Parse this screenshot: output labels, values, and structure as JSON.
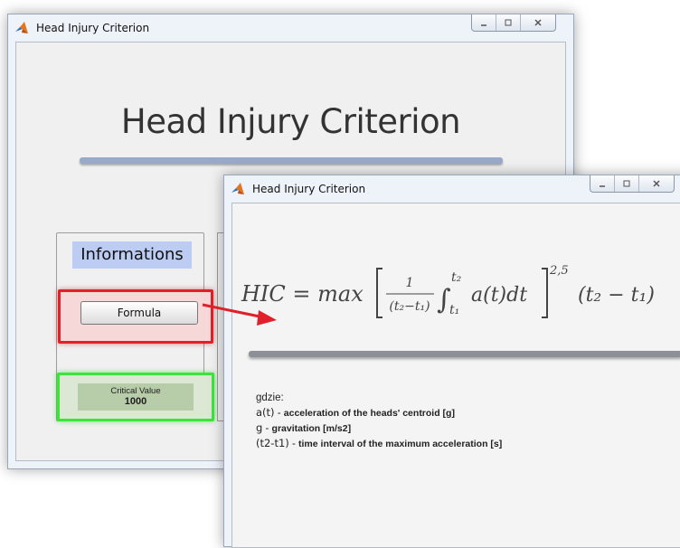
{
  "main_window": {
    "title": "Head Injury Criterion",
    "heading": "Head Injury Criterion",
    "informations_label": "Informations",
    "formula_button": "Formula",
    "critical_value_label": "Critical Value",
    "critical_value": "1000",
    "window_controls": {
      "minimize": "_",
      "maximize": "▫",
      "close": "x"
    }
  },
  "formula_window": {
    "title": "Head Injury Criterion",
    "formula_text": "HIC = max [ 1/(t2−t1) ∫_{t1}^{t2} a(t)dt ]^{2,5} (t2 − t1)",
    "formula_parts": {
      "lhs": "HIC = max",
      "frac_num": "1",
      "frac_den": "(t₂−t₁)",
      "int_upper": "t₂",
      "int_lower": "t₁",
      "integrand": "a(t)dt",
      "exponent": "2,5",
      "tail": "(t₂ − t₁)"
    },
    "notes_heading": "gdzie:",
    "notes": [
      {
        "symbol": "a(t)",
        "desc": "acceleration of the heads' centroid [g]"
      },
      {
        "symbol": "g",
        "desc": "gravitation [m/s2]"
      },
      {
        "symbol": "(t2-t1)",
        "desc": "time interval of the maximum acceleration [s]"
      }
    ],
    "window_controls": {
      "minimize": "_",
      "maximize": "▫",
      "close": "x"
    }
  },
  "colors": {
    "highlight_red": "#e0212b",
    "highlight_green": "#3be53b",
    "arrow": "#e0212b",
    "title_band": "#bcccf2"
  }
}
